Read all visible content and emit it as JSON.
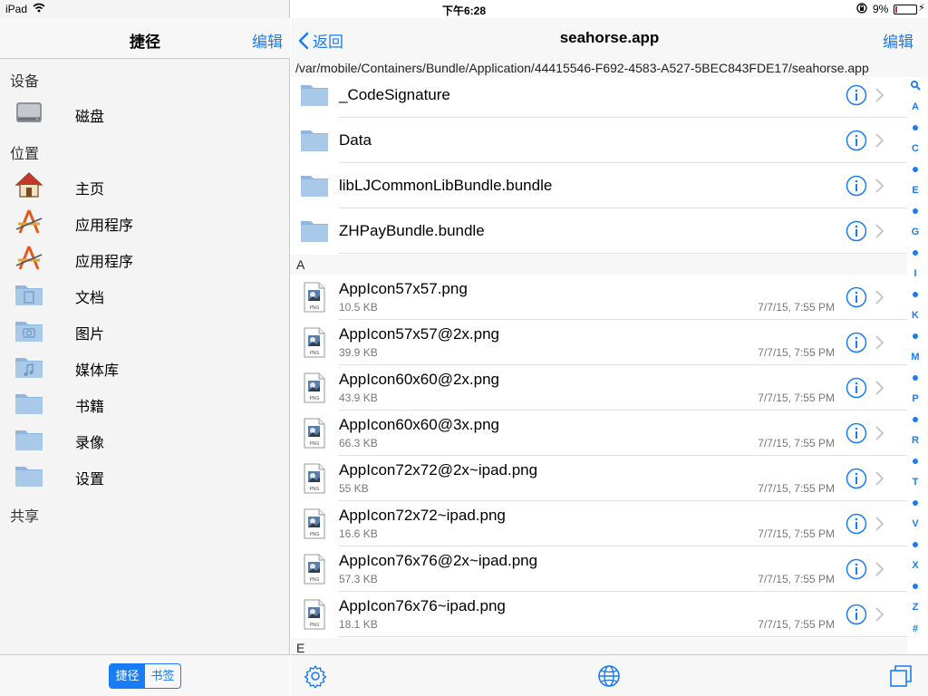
{
  "status_bar": {
    "device": "iPad",
    "time": "下午6:28",
    "battery_percent_text": "9%",
    "battery_level": 0.09
  },
  "left_panel": {
    "title": "捷径",
    "edit_label": "编辑",
    "sections": {
      "devices": "设备",
      "locations": "位置",
      "shared": "共享"
    },
    "device_items": [
      {
        "label": "磁盘",
        "icon": "hard-drive-icon"
      }
    ],
    "location_items": [
      {
        "label": "主页",
        "icon": "home-icon"
      },
      {
        "label": "应用程序",
        "icon": "applications-icon"
      },
      {
        "label": "应用程序",
        "icon": "applications-icon"
      },
      {
        "label": "文档",
        "icon": "documents-folder-icon"
      },
      {
        "label": "图片",
        "icon": "pictures-folder-icon"
      },
      {
        "label": "媒体库",
        "icon": "music-folder-icon"
      },
      {
        "label": "书籍",
        "icon": "folder-icon"
      },
      {
        "label": "录像",
        "icon": "folder-icon"
      },
      {
        "label": "设置",
        "icon": "folder-icon"
      }
    ],
    "segments": {
      "shortcuts": "捷径",
      "bookmarks": "书签"
    }
  },
  "right_panel": {
    "back_label": "返回",
    "title": "seahorse.app",
    "edit_label": "编辑",
    "path": "/var/mobile/Containers/Bundle/Application/44415546-F692-4583-A527-5BEC843FDE17/seahorse.app",
    "folders": [
      {
        "name": "_CodeSignature"
      },
      {
        "name": "Data"
      },
      {
        "name": "libLJCommonLibBundle.bundle"
      },
      {
        "name": "ZHPayBundle.bundle"
      }
    ],
    "section_a": "A",
    "files": [
      {
        "name": "AppIcon57x57.png",
        "size": "10.5 KB",
        "date": "7/7/15, 7:55 PM"
      },
      {
        "name": "AppIcon57x57@2x.png",
        "size": "39.9 KB",
        "date": "7/7/15, 7:55 PM"
      },
      {
        "name": "AppIcon60x60@2x.png",
        "size": "43.9 KB",
        "date": "7/7/15, 7:55 PM"
      },
      {
        "name": "AppIcon60x60@3x.png",
        "size": "66.3 KB",
        "date": "7/7/15, 7:55 PM"
      },
      {
        "name": "AppIcon72x72@2x~ipad.png",
        "size": "55 KB",
        "date": "7/7/15, 7:55 PM"
      },
      {
        "name": "AppIcon72x72~ipad.png",
        "size": "16.6 KB",
        "date": "7/7/15, 7:55 PM"
      },
      {
        "name": "AppIcon76x76@2x~ipad.png",
        "size": "57.3 KB",
        "date": "7/7/15, 7:55 PM"
      },
      {
        "name": "AppIcon76x76~ipad.png",
        "size": "18.1 KB",
        "date": "7/7/15, 7:55 PM"
      }
    ],
    "section_e": "E",
    "index_letters": [
      "A",
      "C",
      "E",
      "G",
      "I",
      "K",
      "M",
      "P",
      "R",
      "T",
      "V",
      "X",
      "Z",
      "#"
    ],
    "file_type_label": "PNG"
  },
  "colors": {
    "accent": "#1a7cf5",
    "folder": "#8fb7dd"
  }
}
